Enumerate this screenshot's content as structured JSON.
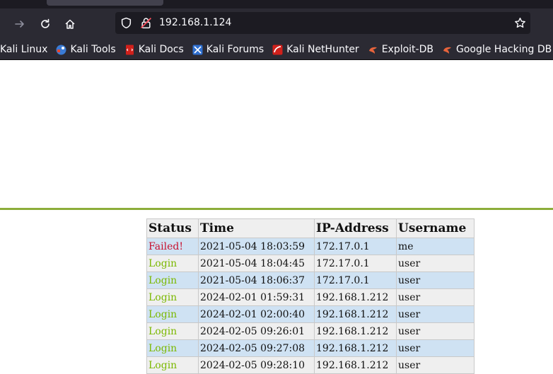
{
  "browser": {
    "url": "192.168.1.124",
    "bookmarks": [
      {
        "label": "Kali Linux",
        "icon": "kali-linux-icon"
      },
      {
        "label": "Kali Tools",
        "icon": "kali-tools-icon"
      },
      {
        "label": "Kali Docs",
        "icon": "kali-docs-icon"
      },
      {
        "label": "Kali Forums",
        "icon": "kali-forums-icon"
      },
      {
        "label": "Kali NetHunter",
        "icon": "kali-nethunter-icon"
      },
      {
        "label": "Exploit-DB",
        "icon": "exploit-db-icon"
      },
      {
        "label": "Google Hacking DB",
        "icon": "google-hacking-db-icon"
      }
    ]
  },
  "table": {
    "headers": [
      "Status",
      "Time",
      "IP-Address",
      "Username"
    ],
    "rows": [
      {
        "status": "Failed!",
        "time": "2021-05-04 18:03:59",
        "ip": "172.17.0.1",
        "user": "me"
      },
      {
        "status": "Login",
        "time": "2021-05-04 18:04:45",
        "ip": "172.17.0.1",
        "user": "user"
      },
      {
        "status": "Login",
        "time": "2021-05-04 18:06:37",
        "ip": "172.17.0.1",
        "user": "user"
      },
      {
        "status": "Login",
        "time": "2024-02-01 01:59:31",
        "ip": "192.168.1.212",
        "user": "user"
      },
      {
        "status": "Login",
        "time": "2024-02-01 02:00:40",
        "ip": "192.168.1.212",
        "user": "user"
      },
      {
        "status": "Login",
        "time": "2024-02-05 09:26:01",
        "ip": "192.168.1.212",
        "user": "user"
      },
      {
        "status": "Login",
        "time": "2024-02-05 09:27:08",
        "ip": "192.168.1.212",
        "user": "user"
      },
      {
        "status": "Login",
        "time": "2024-02-05 09:28:10",
        "ip": "192.168.1.212",
        "user": "user"
      }
    ]
  },
  "colors": {
    "failed": "#c8102e",
    "login": "#7bb800",
    "rule": "#8cad3a"
  }
}
